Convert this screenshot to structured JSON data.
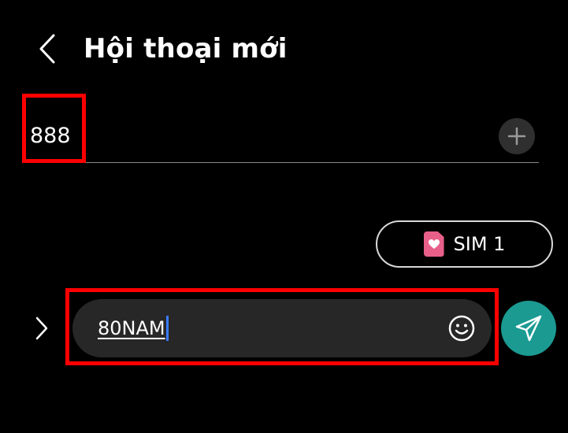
{
  "header": {
    "title": "Hội thoại mới",
    "back_icon": "chevron-left-icon"
  },
  "recipient": {
    "value": "888",
    "add_icon": "plus-icon"
  },
  "sim_selector": {
    "label": "SIM 1",
    "icon": "sim-card-heart-icon",
    "icon_color": "#e8608a"
  },
  "composer": {
    "expand_icon": "chevron-right-icon",
    "message_text": "80NAM",
    "emoji_icon": "smiley-icon",
    "send_icon": "send-icon",
    "send_color": "#1b9a92"
  },
  "colors": {
    "background": "#000000",
    "highlight": "#ff0000",
    "caret": "#3b7cff"
  }
}
